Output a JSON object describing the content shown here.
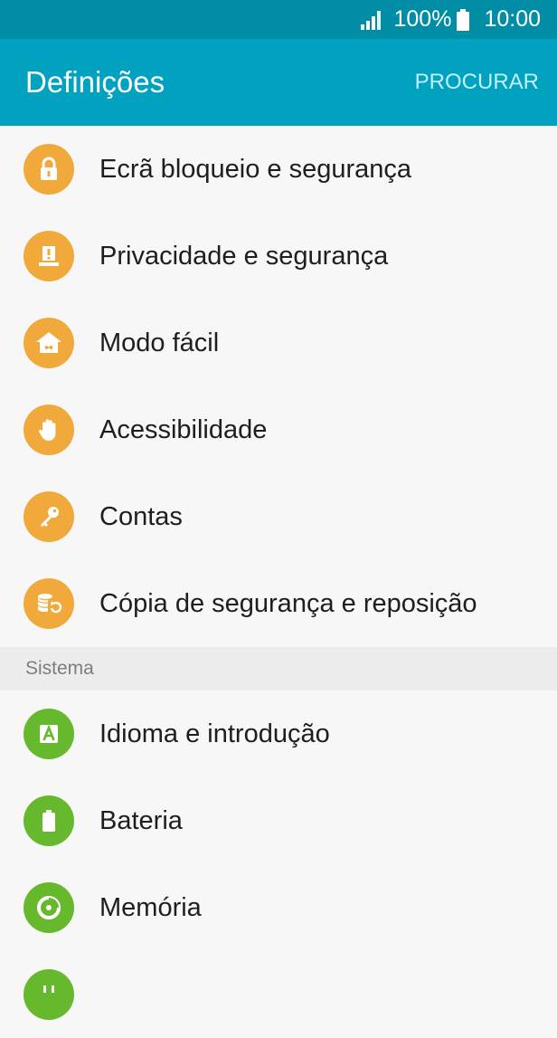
{
  "status_bar": {
    "battery_percent": "100%",
    "time": "10:00",
    "icons": [
      "signal-icon",
      "battery-icon"
    ]
  },
  "app_bar": {
    "title": "Definições",
    "search_label": "PROCURAR"
  },
  "colors": {
    "status_bar_bg": "#008da5",
    "app_bar_bg": "#00a2c0",
    "orange_icon": "#f0a93a",
    "green_icon": "#66b82c"
  },
  "personal_items": [
    {
      "label": "Ecrã bloqueio e segurança",
      "icon": "lock-icon"
    },
    {
      "label": "Privacidade e segurança",
      "icon": "privacy-icon"
    },
    {
      "label": "Modo fácil",
      "icon": "easy-mode-home-icon"
    },
    {
      "label": "Acessibilidade",
      "icon": "hand-icon"
    },
    {
      "label": "Contas",
      "icon": "key-icon"
    },
    {
      "label": "Cópia de segurança e reposição",
      "icon": "backup-icon"
    }
  ],
  "system_section": {
    "header": "Sistema",
    "items": [
      {
        "label": "Idioma e introdução",
        "icon": "language-icon"
      },
      {
        "label": "Bateria",
        "icon": "battery-icon"
      },
      {
        "label": "Memória",
        "icon": "memory-icon"
      },
      {
        "label": "",
        "icon": "partial-icon"
      }
    ]
  }
}
